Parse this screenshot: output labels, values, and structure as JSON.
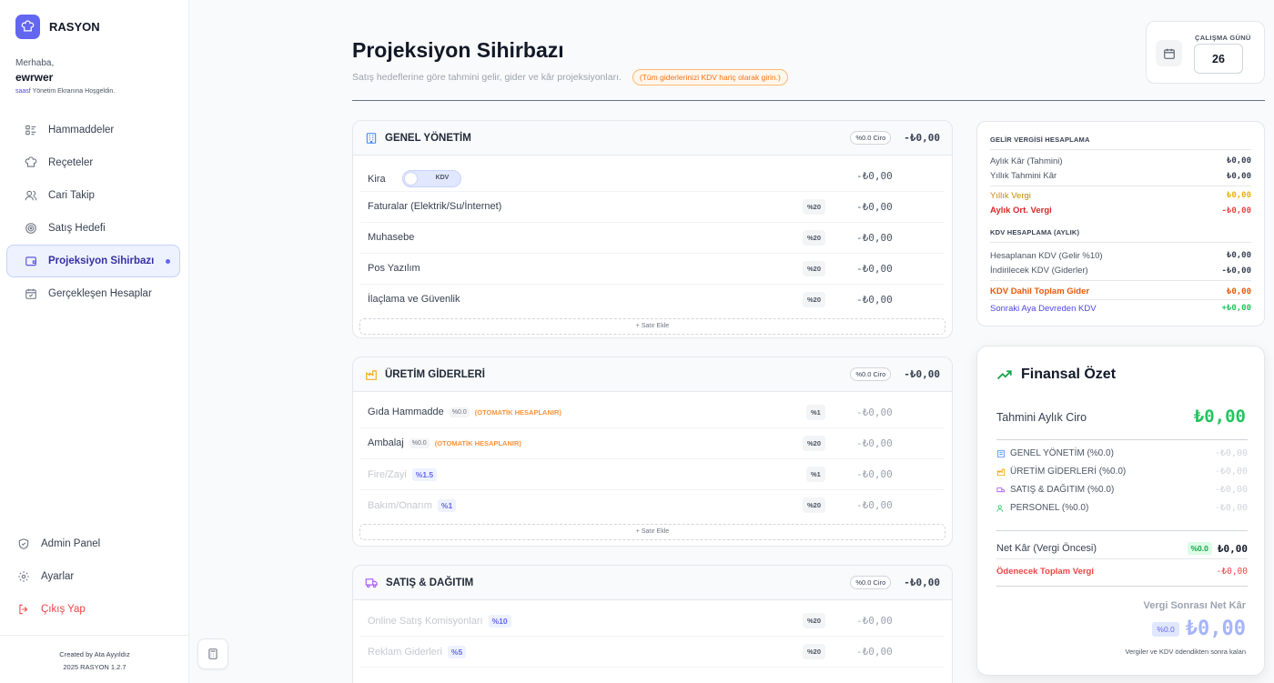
{
  "brand": {
    "name": "RASYON"
  },
  "greeting": {
    "hello": "Merhaba,",
    "user": "ewrwer",
    "tag": "saasf",
    "welcome": "Yönetim Ekranına Hoşgeldin."
  },
  "nav": {
    "items": [
      {
        "label": "Hammaddeler",
        "icon": "list-icon"
      },
      {
        "label": "Reçeteler",
        "icon": "chef-hat-icon"
      },
      {
        "label": "Cari Takip",
        "icon": "users-icon"
      },
      {
        "label": "Satış Hedefi",
        "icon": "target-icon"
      },
      {
        "label": "Projeksiyon Sihirbazı",
        "icon": "wallet-icon",
        "active": true
      },
      {
        "label": "Gerçekleşen Hesaplar",
        "icon": "calendar-check-icon"
      }
    ],
    "bottom": {
      "admin": "Admin Panel",
      "settings": "Ayarlar",
      "logout": "Çıkış Yap"
    }
  },
  "credits": {
    "line1": "Created by Ata Ayyıldız",
    "line2": "2025 RASYON 1.2.7"
  },
  "header": {
    "title": "Projeksiyon Sihirbazı",
    "subtitle": "Satış hedeflerine göre tahmini gelir, gider ve kâr projeksiyonları.",
    "note": "(Tüm giderlerinizi KDV hariç olarak girin.)"
  },
  "workday": {
    "label": "ÇALIŞMA GÜNÜ",
    "value": "26"
  },
  "sections": {
    "genel": {
      "title": "GENEL YÖNETİM",
      "ciro": "%0.0 Ciro",
      "total": "-₺0,00",
      "rows": [
        {
          "name": "Kira",
          "toggle": "KDV",
          "amount": "-₺0,00"
        },
        {
          "name": "Faturalar (Elektrik/Su/İnternet)",
          "vat": "%20",
          "amount": "-₺0,00"
        },
        {
          "name": "Muhasebe",
          "vat": "%20",
          "amount": "-₺0,00"
        },
        {
          "name": "Pos Yazılım",
          "vat": "%20",
          "amount": "-₺0,00"
        },
        {
          "name": "İlaçlama ve Güvenlik",
          "vat": "%20",
          "amount": "-₺0,00"
        }
      ],
      "add": "+ Satır Ekle"
    },
    "uretim": {
      "title": "ÜRETİM GİDERLERİ",
      "ciro": "%0.0 Ciro",
      "total": "-₺0,00",
      "rows": [
        {
          "name": "Gıda Hammadde",
          "pct": "%0.0",
          "auto": "(OTOMATİK HESAPLANIR)",
          "vat": "%1",
          "amount": "-₺0,00"
        },
        {
          "name": "Ambalaj",
          "pct": "%0.0",
          "auto": "(OTOMATİK HESAPLANIR)",
          "vat": "%20",
          "amount": "-₺0,00"
        },
        {
          "name": "Fire/Zayi",
          "pill": "%1.5",
          "vat": "%1",
          "amount": "-₺0,00"
        },
        {
          "name": "Bakım/Onarım",
          "pill": "%1",
          "vat": "%20",
          "amount": "-₺0,00"
        }
      ],
      "add": "+ Satır Ekle"
    },
    "satis": {
      "title": "SATIŞ & DAĞITIM",
      "ciro": "%0.0 Ciro",
      "total": "-₺0,00",
      "rows": [
        {
          "name": "Online Satış Komisyonları",
          "pill": "%10",
          "vat": "%20",
          "amount": "-₺0,00"
        },
        {
          "name": "Reklam Giderleri",
          "pill": "%5",
          "vat": "%20",
          "amount": "-₺0,00"
        }
      ]
    }
  },
  "tax": {
    "income_title": "GELİR VERGİSİ HESAPLAMA",
    "monthly_profit": {
      "label": "Aylık Kâr (Tahmini)",
      "value": "₺0,00"
    },
    "yearly_profit": {
      "label": "Yıllık Tahmini Kâr",
      "value": "₺0,00"
    },
    "yearly_tax": {
      "label": "Yıllık Vergi",
      "value": "₺0,00"
    },
    "monthly_tax": {
      "label": "Aylık Ort. Vergi",
      "value": "-₺0,00"
    },
    "kdv_title": "KDV HESAPLAMA (AYLIK)",
    "kdv_calc": {
      "label": "Hesaplanan KDV (Gelir %10)",
      "value": "₺0,00"
    },
    "kdv_ded": {
      "label": "İndirilecek KDV (Giderler)",
      "value": "-₺0,00"
    },
    "kdv_total": {
      "label": "KDV Dahil Toplam Gider",
      "value": "₺0,00"
    },
    "kdv_next": {
      "label": "Sonraki Aya Devreden KDV",
      "value": "+₺0,00"
    }
  },
  "finance": {
    "title": "Finansal Özet",
    "ciro_label": "Tahmini Aylık Ciro",
    "ciro_value": "₺0,00",
    "cats": [
      {
        "label": "GENEL YÖNETİM (%0.0)",
        "value": "-₺0,00",
        "icon": "building-icon"
      },
      {
        "label": "ÜRETİM GİDERLERİ (%0.0)",
        "value": "-₺0,00",
        "icon": "factory-icon"
      },
      {
        "label": "SATIŞ & DAĞITIM (%0.0)",
        "value": "-₺0,00",
        "icon": "truck-icon"
      },
      {
        "label": "PERSONEL (%0.0)",
        "value": "-₺0,00",
        "icon": "people-icon"
      }
    ],
    "net_label": "Net Kâr (Vergi Öncesi)",
    "net_pct": "%0.0",
    "net_value": "₺0,00",
    "tax_label": "Ödenecek Toplam Vergi",
    "tax_value": "-₺0,00",
    "after_label": "Vergi Sonrası Net Kâr",
    "after_pct": "%0.0",
    "after_value": "₺0,00",
    "footnote": "Vergiler ve KDV ödendikten sonra kalan"
  },
  "colors": {
    "accent": "#6366f1",
    "green": "#22c55e",
    "red": "#ef4444",
    "orange": "#f97316"
  }
}
